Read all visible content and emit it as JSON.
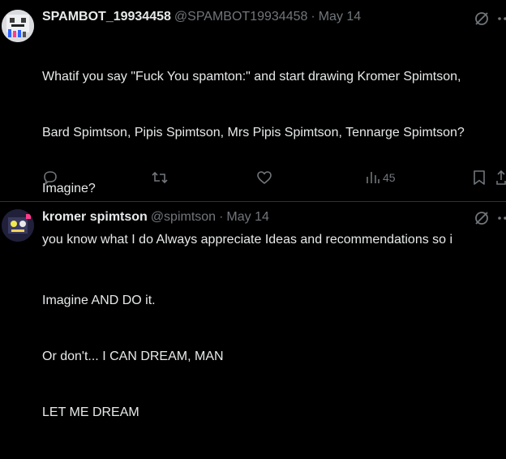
{
  "tweets": [
    {
      "name": "SPAMBOT_19934458",
      "handle": "@SPAMBOT19934458",
      "separator": "·",
      "date": "May 14",
      "text_lines": [
        "Whatif you say \"Fuck You spamton:\" and start drawing Kromer Spimtson,",
        "Bard Spimtson, Pipis Spimtson, Mrs Pipis Spimtson, Tennarge Spimtson?",
        "Imagine?",
        "",
        "Imagine AND DO it.",
        "Or don't... I CAN DREAM, MAN",
        "LET ME DREAM"
      ],
      "actions": {
        "reply_icon": "reply-icon",
        "retweet_icon": "retweet-icon",
        "like_icon": "heart-icon",
        "views_icon": "views-icon",
        "views_count": "45",
        "bookmark_icon": "bookmark-icon",
        "share_icon": "share-icon"
      }
    },
    {
      "name": "kromer spimtson",
      "handle": "@spimtson",
      "separator": "·",
      "date": "May 14",
      "text_lines": [
        "you know what I do Always appreciate   Ideas and recommendations so i"
      ]
    }
  ],
  "icons": {
    "grok": "grok-icon",
    "more": "more-options-icon"
  },
  "colors": {
    "background": "#000000",
    "text_primary": "#e7e9ea",
    "text_secondary": "#71767b",
    "divider": "#2f3336"
  }
}
